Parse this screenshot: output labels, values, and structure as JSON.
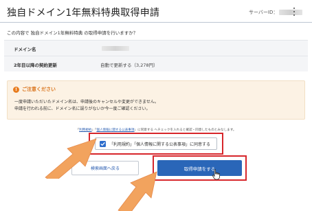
{
  "header": {
    "title": "独自ドメイン1年無料特典取得申請",
    "server_label": "サーバーID：",
    "menu_icon": "kebab-menu-icon"
  },
  "question": "この内容で 独自ドメイン1年無料特典 の取得申請を行いますか？",
  "details": [
    {
      "label": "ドメイン名",
      "value": ""
    },
    {
      "label": "2年目以降の契約更新",
      "value": "自動で更新する（3,278円）"
    }
  ],
  "caution": {
    "icon": "warning-icon",
    "title": "ご注意ください",
    "lines": [
      "一度申請いただいたドメイン名は、申請後のキャンセルや変更ができません。",
      "申請を行われる前に、ドメイン名に誤りがないか今一度ご確認ください。"
    ]
  },
  "terms_note": {
    "prefix": "「",
    "link1": "利用規約",
    "mid": "」「",
    "link2": "個人情報に関する公表事項",
    "suffix": "」に同意する ヘチェックを入れると確認・同意したものとみなします。"
  },
  "agree": {
    "checked": true,
    "label": "「利用規約」「個人情報に関する公表事項」に同意する"
  },
  "buttons": {
    "back": "検索画面へ戻る",
    "submit": "取得申請をする"
  },
  "colors": {
    "accent": "#2a66b8",
    "highlight": "#d7262b",
    "warning": "#e87c1e",
    "caution_bg": "#fcf2e4",
    "arrow": "#f2a35e"
  }
}
